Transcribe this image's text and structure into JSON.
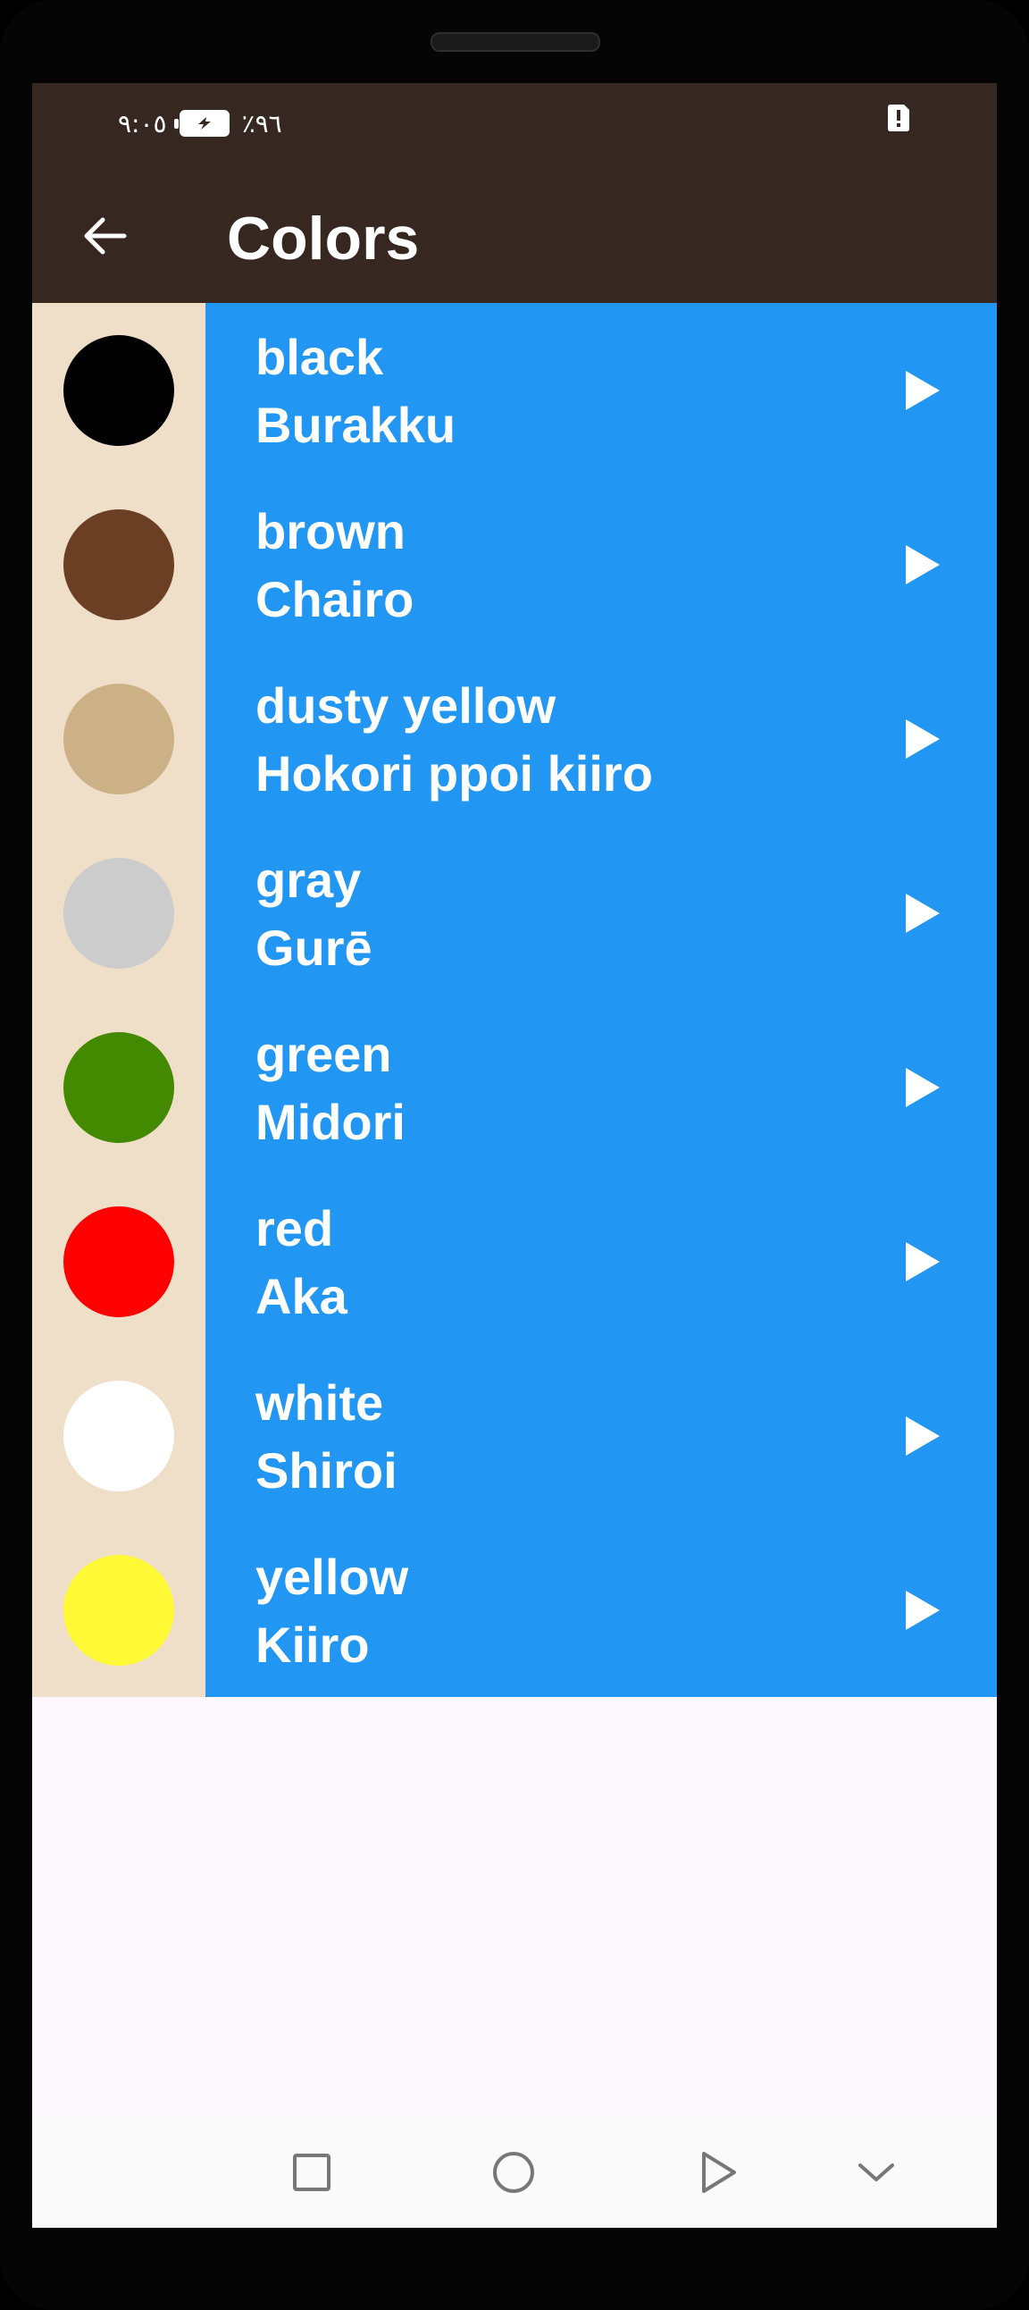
{
  "status_bar": {
    "time": "٩:٠٥",
    "battery": "٪٩٦"
  },
  "app_bar": {
    "title": "Colors"
  },
  "colors": [
    {
      "english": "black",
      "japanese": "Burakku",
      "swatch": "#000000"
    },
    {
      "english": "brown",
      "japanese": "Chairo",
      "swatch": "#6b3f24"
    },
    {
      "english": "dusty yellow",
      "japanese": "Hokori ppoi kiiro",
      "swatch": "#cbb185"
    },
    {
      "english": "gray",
      "japanese": "Gurē",
      "swatch": "#cccccc"
    },
    {
      "english": "green",
      "japanese": "Midori",
      "swatch": "#438a00"
    },
    {
      "english": "red",
      "japanese": "Aka",
      "swatch": "#ff0000"
    },
    {
      "english": "white",
      "japanese": "Shiroi",
      "swatch": "#ffffff"
    },
    {
      "english": "yellow",
      "japanese": "Kiiro",
      "swatch": "#fff936"
    }
  ],
  "theme": {
    "app_bar_color": "#362720",
    "list_color": "#2196f3",
    "swatch_background": "#efdfc9"
  },
  "icons": {
    "back": "arrow-left-icon",
    "play": "play-icon",
    "nav_recents": "square-icon",
    "nav_home": "circle-icon",
    "nav_back": "triangle-icon",
    "nav_collapse": "chevron-down-icon"
  }
}
